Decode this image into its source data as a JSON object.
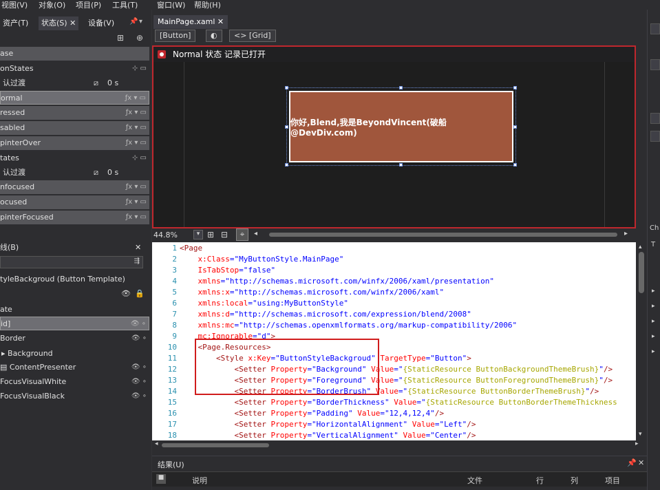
{
  "menu": [
    "视图(V)",
    "对象(O)",
    "项目(P)",
    "工具(T)",
    "窗口(W)",
    "帮助(H)"
  ],
  "left": {
    "tabs": [
      "资产(T)",
      "状态(S)",
      "设备(V)"
    ],
    "states": [
      {
        "label": "ase"
      },
      {
        "label": "onStates"
      },
      {
        "label": "认过渡",
        "dur": "0 s"
      },
      {
        "label": "ormal"
      },
      {
        "label": "ressed"
      },
      {
        "label": "sabled"
      },
      {
        "label": "pinterOver"
      },
      {
        "label": "tates"
      },
      {
        "label": "认过渡",
        "dur": "0 s"
      },
      {
        "label": "nfocused"
      },
      {
        "label": "ocused"
      },
      {
        "label": "pinterFocused"
      }
    ],
    "objects_title": "线(B)",
    "objects": [
      "tyleBackgroud (Button Template)",
      "ate",
      "id]",
      "Border",
      "Background",
      "ContentPresenter",
      "FocusVisualWhite",
      "FocusVisualBlack"
    ]
  },
  "doc": {
    "tab": "MainPage.xaml",
    "breadcrumb": [
      "[Button]",
      "<> [Grid]"
    ],
    "state_text": "Normal 状态 记录已打开",
    "button_text": "你好,Blend,我是BeyondVincent(破船@DevDiv.com)",
    "zoom": "44.8%"
  },
  "code": [
    {
      "n": "1",
      "parts": [
        [
          "t",
          "<Page"
        ]
      ]
    },
    {
      "n": "2",
      "parts": [
        [
          "a",
          "    x:Class"
        ],
        [
          "v",
          "=\"MyButtonStyle.MainPage\""
        ]
      ]
    },
    {
      "n": "3",
      "parts": [
        [
          "a",
          "    IsTabStop"
        ],
        [
          "v",
          "=\"false\""
        ]
      ]
    },
    {
      "n": "4",
      "parts": [
        [
          "a",
          "    xmlns"
        ],
        [
          "v",
          "=\"http://schemas.microsoft.com/winfx/2006/xaml/presentation\""
        ]
      ]
    },
    {
      "n": "5",
      "parts": [
        [
          "a",
          "    xmlns:x"
        ],
        [
          "v",
          "=\"http://schemas.microsoft.com/winfx/2006/xaml\""
        ]
      ]
    },
    {
      "n": "6",
      "parts": [
        [
          "a",
          "    xmlns:local"
        ],
        [
          "v",
          "=\"using:MyButtonStyle\""
        ]
      ]
    },
    {
      "n": "7",
      "parts": [
        [
          "a",
          "    xmlns:d"
        ],
        [
          "v",
          "=\"http://schemas.microsoft.com/expression/blend/2008\""
        ]
      ]
    },
    {
      "n": "8",
      "parts": [
        [
          "a",
          "    xmlns:mc"
        ],
        [
          "v",
          "=\"http://schemas.openxmlformats.org/markup-compatibility/2006\""
        ]
      ]
    },
    {
      "n": "9",
      "parts": [
        [
          "a",
          "    mc:Ignorable"
        ],
        [
          "v",
          "=\"d\""
        ],
        [
          "t",
          ">"
        ]
      ]
    },
    {
      "n": "10",
      "parts": [
        [
          "t",
          "    <Page.Resources>"
        ]
      ]
    },
    {
      "n": "11",
      "parts": [
        [
          "t",
          "        <Style "
        ],
        [
          "a",
          "x:Key"
        ],
        [
          "v",
          "=\"ButtonStyleBackgroud\" "
        ],
        [
          "a",
          "TargetType"
        ],
        [
          "v",
          "=\"Button\""
        ],
        [
          "t",
          ">"
        ]
      ]
    },
    {
      "n": "12",
      "parts": [
        [
          "t",
          "            <Setter "
        ],
        [
          "a",
          "Property"
        ],
        [
          "v",
          "=\"Background\" "
        ],
        [
          "a",
          "Value"
        ],
        [
          "v",
          "=\""
        ],
        [
          "m",
          "{StaticResource ButtonBackgroundThemeBrush}"
        ],
        [
          "v",
          "\""
        ],
        [
          "t",
          "/>"
        ]
      ]
    },
    {
      "n": "13",
      "parts": [
        [
          "t",
          "            <Setter "
        ],
        [
          "a",
          "Property"
        ],
        [
          "v",
          "=\"Foreground\" "
        ],
        [
          "a",
          "Value"
        ],
        [
          "v",
          "=\""
        ],
        [
          "m",
          "{StaticResource ButtonForegroundThemeBrush}"
        ],
        [
          "v",
          "\""
        ],
        [
          "t",
          "/>"
        ]
      ]
    },
    {
      "n": "14",
      "parts": [
        [
          "t",
          "            <Setter "
        ],
        [
          "a",
          "Property"
        ],
        [
          "v",
          "=\"BorderBrush\" "
        ],
        [
          "a",
          "Value"
        ],
        [
          "v",
          "=\""
        ],
        [
          "m",
          "{StaticResource ButtonBorderThemeBrush}"
        ],
        [
          "v",
          "\""
        ],
        [
          "t",
          "/>"
        ]
      ]
    },
    {
      "n": "15",
      "parts": [
        [
          "t",
          "            <Setter "
        ],
        [
          "a",
          "Property"
        ],
        [
          "v",
          "=\"BorderThickness\" "
        ],
        [
          "a",
          "Value"
        ],
        [
          "v",
          "=\""
        ],
        [
          "m",
          "{StaticResource ButtonBorderThemeThickness"
        ]
      ]
    },
    {
      "n": "16",
      "parts": [
        [
          "t",
          "            <Setter "
        ],
        [
          "a",
          "Property"
        ],
        [
          "v",
          "=\"Padding\" "
        ],
        [
          "a",
          "Value"
        ],
        [
          "v",
          "=\"12,4,12,4\""
        ],
        [
          "t",
          "/>"
        ]
      ]
    },
    {
      "n": "17",
      "parts": [
        [
          "t",
          "            <Setter "
        ],
        [
          "a",
          "Property"
        ],
        [
          "v",
          "=\"HorizontalAlignment\" "
        ],
        [
          "a",
          "Value"
        ],
        [
          "v",
          "=\"Left\""
        ],
        [
          "t",
          "/>"
        ]
      ]
    },
    {
      "n": "18",
      "parts": [
        [
          "t",
          "            <Setter "
        ],
        [
          "a",
          "Property"
        ],
        [
          "v",
          "=\"VerticalAlignment\" "
        ],
        [
          "a",
          "Value"
        ],
        [
          "v",
          "=\"Center\""
        ],
        [
          "t",
          "/>"
        ]
      ]
    }
  ],
  "results": {
    "title": "结果(U)",
    "columns": [
      "说明",
      "文件",
      "行",
      "列",
      "项目"
    ]
  },
  "right": {
    "labels": [
      "Ch",
      "T"
    ]
  }
}
